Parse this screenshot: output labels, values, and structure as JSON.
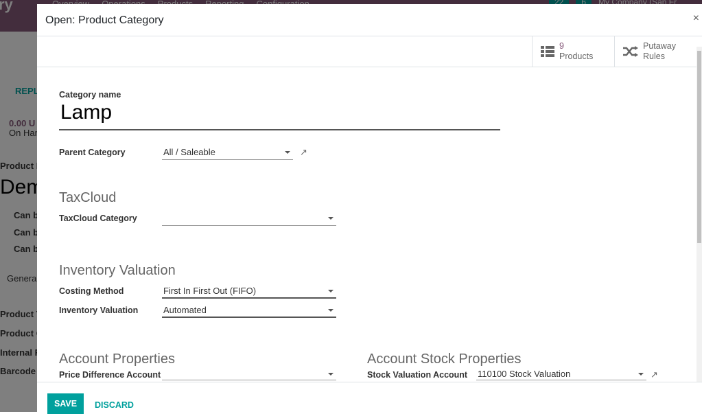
{
  "topbar": {
    "app_name": "ry",
    "menu": [
      "Overview",
      "Operations",
      "Products",
      "Reporting",
      "Configuration"
    ],
    "activity_count": "22",
    "chat_count": "6",
    "company": "My Company (San Fr"
  },
  "background": {
    "replenish": "REPL",
    "on_hand_qty": "0.00 U",
    "on_hand": "On Han",
    "product_name_label": "Product N",
    "product_name": "Dem",
    "checks": [
      {
        "label": "Can b",
        "checked": true
      },
      {
        "label": "Can b",
        "checked": true
      },
      {
        "label": "Can b",
        "checked": false
      }
    ],
    "tab": "General",
    "fields": [
      "Product T",
      "Product C",
      "Internal R",
      "Barcode"
    ]
  },
  "modal": {
    "title": "Open: Product Category",
    "close": "×",
    "smart_buttons": [
      {
        "icon": "list-icon",
        "value": "9",
        "label": "Products"
      },
      {
        "icon": "shuffle-icon",
        "value": "Putaway",
        "label": "Rules"
      }
    ],
    "category_name_label": "Category name",
    "category_name": "Lamp",
    "parent_category_label": "Parent Category",
    "parent_category": "All / Saleable",
    "taxcloud_heading": "TaxCloud",
    "taxcloud_category_label": "TaxCloud Category",
    "taxcloud_category": "",
    "inventory_heading": "Inventory Valuation",
    "costing_method_label": "Costing Method",
    "costing_method": "First In First Out (FIFO)",
    "inventory_valuation_label": "Inventory Valuation",
    "inventory_valuation": "Automated",
    "account_heading": "Account Properties",
    "price_diff_label": "Price Difference Account",
    "price_diff": "",
    "stock_heading": "Account Stock Properties",
    "stock_valuation_label": "Stock Valuation Account",
    "stock_valuation": "110100 Stock Valuation",
    "save": "SAVE",
    "discard": "DISCARD"
  },
  "colors": {
    "brand": "#875a7b",
    "accent": "#00a09d"
  }
}
